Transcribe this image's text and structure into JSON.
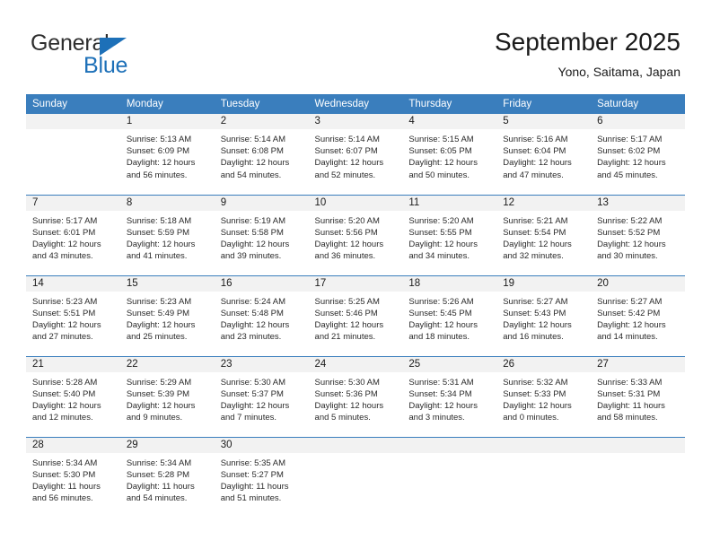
{
  "brand": {
    "name_part1": "General",
    "name_part2": "Blue"
  },
  "header": {
    "title": "September 2025",
    "subtitle": "Yono, Saitama, Japan"
  },
  "colors": {
    "header_blue": "#3a7ebd",
    "brand_blue": "#1d70b8",
    "daynum_band": "#f2f2f2"
  },
  "weekdays": [
    "Sunday",
    "Monday",
    "Tuesday",
    "Wednesday",
    "Thursday",
    "Friday",
    "Saturday"
  ],
  "weeks": [
    [
      {
        "day": "",
        "sunrise": "",
        "sunset": "",
        "daylight1": "",
        "daylight2": ""
      },
      {
        "day": "1",
        "sunrise": "Sunrise: 5:13 AM",
        "sunset": "Sunset: 6:09 PM",
        "daylight1": "Daylight: 12 hours",
        "daylight2": "and 56 minutes."
      },
      {
        "day": "2",
        "sunrise": "Sunrise: 5:14 AM",
        "sunset": "Sunset: 6:08 PM",
        "daylight1": "Daylight: 12 hours",
        "daylight2": "and 54 minutes."
      },
      {
        "day": "3",
        "sunrise": "Sunrise: 5:14 AM",
        "sunset": "Sunset: 6:07 PM",
        "daylight1": "Daylight: 12 hours",
        "daylight2": "and 52 minutes."
      },
      {
        "day": "4",
        "sunrise": "Sunrise: 5:15 AM",
        "sunset": "Sunset: 6:05 PM",
        "daylight1": "Daylight: 12 hours",
        "daylight2": "and 50 minutes."
      },
      {
        "day": "5",
        "sunrise": "Sunrise: 5:16 AM",
        "sunset": "Sunset: 6:04 PM",
        "daylight1": "Daylight: 12 hours",
        "daylight2": "and 47 minutes."
      },
      {
        "day": "6",
        "sunrise": "Sunrise: 5:17 AM",
        "sunset": "Sunset: 6:02 PM",
        "daylight1": "Daylight: 12 hours",
        "daylight2": "and 45 minutes."
      }
    ],
    [
      {
        "day": "7",
        "sunrise": "Sunrise: 5:17 AM",
        "sunset": "Sunset: 6:01 PM",
        "daylight1": "Daylight: 12 hours",
        "daylight2": "and 43 minutes."
      },
      {
        "day": "8",
        "sunrise": "Sunrise: 5:18 AM",
        "sunset": "Sunset: 5:59 PM",
        "daylight1": "Daylight: 12 hours",
        "daylight2": "and 41 minutes."
      },
      {
        "day": "9",
        "sunrise": "Sunrise: 5:19 AM",
        "sunset": "Sunset: 5:58 PM",
        "daylight1": "Daylight: 12 hours",
        "daylight2": "and 39 minutes."
      },
      {
        "day": "10",
        "sunrise": "Sunrise: 5:20 AM",
        "sunset": "Sunset: 5:56 PM",
        "daylight1": "Daylight: 12 hours",
        "daylight2": "and 36 minutes."
      },
      {
        "day": "11",
        "sunrise": "Sunrise: 5:20 AM",
        "sunset": "Sunset: 5:55 PM",
        "daylight1": "Daylight: 12 hours",
        "daylight2": "and 34 minutes."
      },
      {
        "day": "12",
        "sunrise": "Sunrise: 5:21 AM",
        "sunset": "Sunset: 5:54 PM",
        "daylight1": "Daylight: 12 hours",
        "daylight2": "and 32 minutes."
      },
      {
        "day": "13",
        "sunrise": "Sunrise: 5:22 AM",
        "sunset": "Sunset: 5:52 PM",
        "daylight1": "Daylight: 12 hours",
        "daylight2": "and 30 minutes."
      }
    ],
    [
      {
        "day": "14",
        "sunrise": "Sunrise: 5:23 AM",
        "sunset": "Sunset: 5:51 PM",
        "daylight1": "Daylight: 12 hours",
        "daylight2": "and 27 minutes."
      },
      {
        "day": "15",
        "sunrise": "Sunrise: 5:23 AM",
        "sunset": "Sunset: 5:49 PM",
        "daylight1": "Daylight: 12 hours",
        "daylight2": "and 25 minutes."
      },
      {
        "day": "16",
        "sunrise": "Sunrise: 5:24 AM",
        "sunset": "Sunset: 5:48 PM",
        "daylight1": "Daylight: 12 hours",
        "daylight2": "and 23 minutes."
      },
      {
        "day": "17",
        "sunrise": "Sunrise: 5:25 AM",
        "sunset": "Sunset: 5:46 PM",
        "daylight1": "Daylight: 12 hours",
        "daylight2": "and 21 minutes."
      },
      {
        "day": "18",
        "sunrise": "Sunrise: 5:26 AM",
        "sunset": "Sunset: 5:45 PM",
        "daylight1": "Daylight: 12 hours",
        "daylight2": "and 18 minutes."
      },
      {
        "day": "19",
        "sunrise": "Sunrise: 5:27 AM",
        "sunset": "Sunset: 5:43 PM",
        "daylight1": "Daylight: 12 hours",
        "daylight2": "and 16 minutes."
      },
      {
        "day": "20",
        "sunrise": "Sunrise: 5:27 AM",
        "sunset": "Sunset: 5:42 PM",
        "daylight1": "Daylight: 12 hours",
        "daylight2": "and 14 minutes."
      }
    ],
    [
      {
        "day": "21",
        "sunrise": "Sunrise: 5:28 AM",
        "sunset": "Sunset: 5:40 PM",
        "daylight1": "Daylight: 12 hours",
        "daylight2": "and 12 minutes."
      },
      {
        "day": "22",
        "sunrise": "Sunrise: 5:29 AM",
        "sunset": "Sunset: 5:39 PM",
        "daylight1": "Daylight: 12 hours",
        "daylight2": "and 9 minutes."
      },
      {
        "day": "23",
        "sunrise": "Sunrise: 5:30 AM",
        "sunset": "Sunset: 5:37 PM",
        "daylight1": "Daylight: 12 hours",
        "daylight2": "and 7 minutes."
      },
      {
        "day": "24",
        "sunrise": "Sunrise: 5:30 AM",
        "sunset": "Sunset: 5:36 PM",
        "daylight1": "Daylight: 12 hours",
        "daylight2": "and 5 minutes."
      },
      {
        "day": "25",
        "sunrise": "Sunrise: 5:31 AM",
        "sunset": "Sunset: 5:34 PM",
        "daylight1": "Daylight: 12 hours",
        "daylight2": "and 3 minutes."
      },
      {
        "day": "26",
        "sunrise": "Sunrise: 5:32 AM",
        "sunset": "Sunset: 5:33 PM",
        "daylight1": "Daylight: 12 hours",
        "daylight2": "and 0 minutes."
      },
      {
        "day": "27",
        "sunrise": "Sunrise: 5:33 AM",
        "sunset": "Sunset: 5:31 PM",
        "daylight1": "Daylight: 11 hours",
        "daylight2": "and 58 minutes."
      }
    ],
    [
      {
        "day": "28",
        "sunrise": "Sunrise: 5:34 AM",
        "sunset": "Sunset: 5:30 PM",
        "daylight1": "Daylight: 11 hours",
        "daylight2": "and 56 minutes."
      },
      {
        "day": "29",
        "sunrise": "Sunrise: 5:34 AM",
        "sunset": "Sunset: 5:28 PM",
        "daylight1": "Daylight: 11 hours",
        "daylight2": "and 54 minutes."
      },
      {
        "day": "30",
        "sunrise": "Sunrise: 5:35 AM",
        "sunset": "Sunset: 5:27 PM",
        "daylight1": "Daylight: 11 hours",
        "daylight2": "and 51 minutes."
      },
      {
        "day": "",
        "sunrise": "",
        "sunset": "",
        "daylight1": "",
        "daylight2": ""
      },
      {
        "day": "",
        "sunrise": "",
        "sunset": "",
        "daylight1": "",
        "daylight2": ""
      },
      {
        "day": "",
        "sunrise": "",
        "sunset": "",
        "daylight1": "",
        "daylight2": ""
      },
      {
        "day": "",
        "sunrise": "",
        "sunset": "",
        "daylight1": "",
        "daylight2": ""
      }
    ]
  ]
}
